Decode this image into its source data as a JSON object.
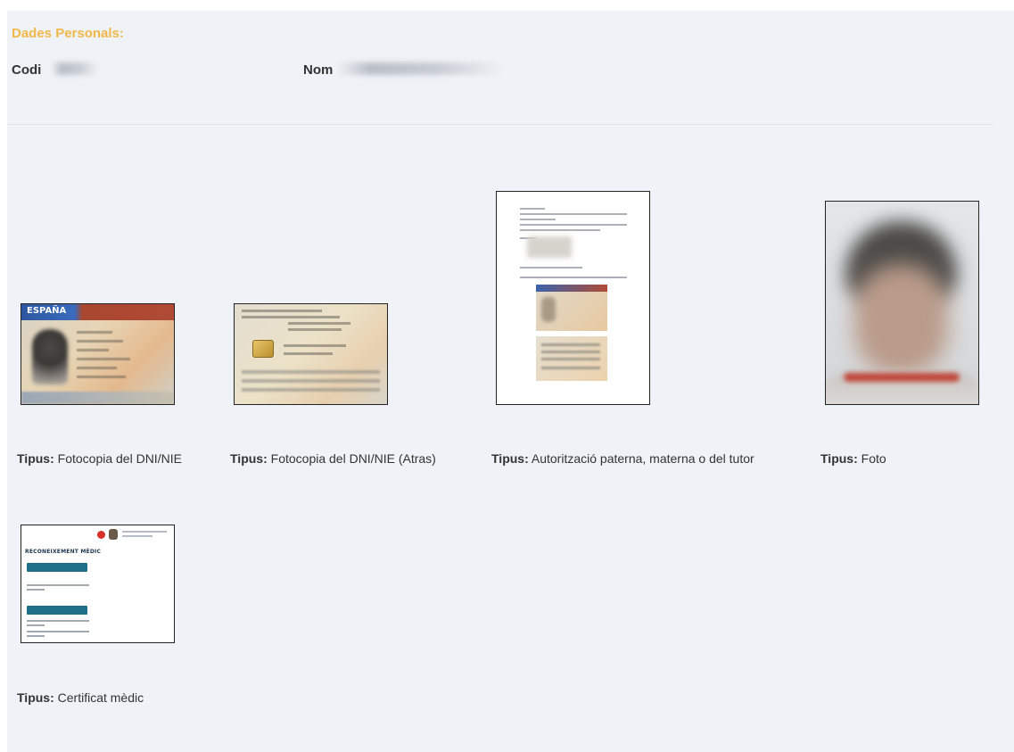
{
  "personal": {
    "title": "Dades Personals:",
    "code_label": "Codi",
    "name_label": "Nom"
  },
  "documents": [
    {
      "type_label": "Tipus:",
      "type_value": "Fotocopia del DNI/NIE",
      "thumbnail": "id-card-front"
    },
    {
      "type_label": "Tipus:",
      "type_value": "Fotocopia del DNI/NIE (Atras)",
      "thumbnail": "id-card-back"
    },
    {
      "type_label": "Tipus:",
      "type_value": "Autorització paterna, materna o del tutor",
      "thumbnail": "authorization-document"
    },
    {
      "type_label": "Tipus:",
      "type_value": "Foto",
      "thumbnail": "portrait-photo"
    },
    {
      "type_label": "Tipus:",
      "type_value": "Certificat mèdic",
      "thumbnail": "medical-certificate"
    }
  ],
  "thumb_text": {
    "dni_front_header": "ESPAÑA",
    "med_title": "RECONEIXEMENT MÈDIC"
  },
  "colors": {
    "section_title": "#f0b84a",
    "panel_bg": "#eff2f6"
  }
}
